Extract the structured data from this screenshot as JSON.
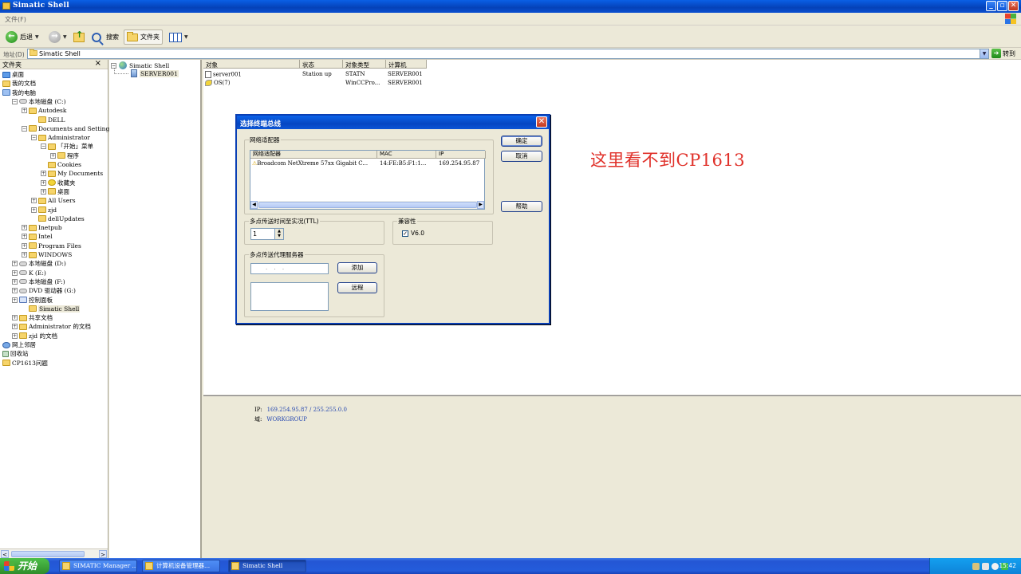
{
  "window": {
    "title": "Simatic Shell",
    "controls": [
      "_",
      "▫",
      "✕"
    ]
  },
  "menubar": {
    "file_label": "文件(F)"
  },
  "toolbar": {
    "back_label": "后退",
    "search_label": "搜索",
    "folders_label": "文件夹"
  },
  "address": {
    "label": "地址(D)",
    "value": "Simatic Shell",
    "go_label": "转到"
  },
  "folder_pane": {
    "header": "文件夹",
    "close": "×",
    "items": [
      {
        "label": "桌面",
        "expander": "",
        "icon": "desktop-icon"
      },
      {
        "label": "我的文档",
        "expander": "",
        "icon": "folder-icon"
      },
      {
        "label": "我的电脑",
        "expander": "",
        "icon": "computer-icon"
      },
      {
        "label": "本地磁盘 (C:)",
        "expander": "−",
        "icon": "drive-icon"
      },
      {
        "label": "Autodesk",
        "expander": "+",
        "icon": "folder-icon"
      },
      {
        "label": "DELL",
        "expander": "",
        "icon": "folder-icon"
      },
      {
        "label": "Documents and Settings",
        "expander": "−",
        "icon": "folder-icon"
      },
      {
        "label": "Administrator",
        "expander": "−",
        "icon": "folder-icon"
      },
      {
        "label": "「开始」菜单",
        "expander": "−",
        "icon": "folder-icon"
      },
      {
        "label": "程序",
        "expander": "+",
        "icon": "folder-icon"
      },
      {
        "label": "Cookies",
        "expander": "",
        "icon": "folder-icon"
      },
      {
        "label": "My Documents",
        "expander": "+",
        "icon": "folder-icon"
      },
      {
        "label": "收藏夹",
        "expander": "+",
        "icon": "star-icon"
      },
      {
        "label": "桌面",
        "expander": "+",
        "icon": "folder-icon"
      },
      {
        "label": "All Users",
        "expander": "+",
        "icon": "folder-icon"
      },
      {
        "label": "zjd",
        "expander": "+",
        "icon": "folder-icon"
      },
      {
        "label": "dellUpdates",
        "expander": "",
        "icon": "folder-icon"
      },
      {
        "label": "Inetpub",
        "expander": "+",
        "icon": "folder-icon"
      },
      {
        "label": "Intel",
        "expander": "+",
        "icon": "folder-icon"
      },
      {
        "label": "Program Files",
        "expander": "+",
        "icon": "folder-icon"
      },
      {
        "label": "WINDOWS",
        "expander": "+",
        "icon": "folder-icon"
      },
      {
        "label": "本地磁盘 (D:)",
        "expander": "+",
        "icon": "drive-icon"
      },
      {
        "label": "K (E:)",
        "expander": "+",
        "icon": "drive-icon"
      },
      {
        "label": "本地磁盘 (F:)",
        "expander": "+",
        "icon": "drive-icon"
      },
      {
        "label": "DVD 驱动器 (G:)",
        "expander": "+",
        "icon": "dvd-icon"
      },
      {
        "label": "控制面板",
        "expander": "+",
        "icon": "control-panel-icon"
      },
      {
        "label": "Simatic Shell",
        "expander": "",
        "icon": "folder-icon"
      },
      {
        "label": "共享文档",
        "expander": "+",
        "icon": "folder-icon"
      },
      {
        "label": "Administrator 的文档",
        "expander": "+",
        "icon": "folder-icon"
      },
      {
        "label": "zjd 的文档",
        "expander": "+",
        "icon": "folder-icon"
      },
      {
        "label": "网上邻居",
        "expander": "",
        "icon": "network-icon"
      },
      {
        "label": "回收站",
        "expander": "",
        "icon": "recycle-bin-icon"
      },
      {
        "label": "CP1613问题",
        "expander": "",
        "icon": "folder-icon"
      }
    ]
  },
  "project_tree": {
    "root": "Simatic Shell",
    "child": "SERVER001"
  },
  "object_list": {
    "columns": [
      "对象",
      "状态",
      "对象类型",
      "计算机"
    ],
    "rows": [
      {
        "object": "server001",
        "status": "Station up",
        "type": "STATN",
        "computer": "SERVER001"
      },
      {
        "object": "OS(7)",
        "status": "",
        "type": "WinCCPro...",
        "computer": "SERVER001"
      }
    ]
  },
  "annotation": "这里看不到CP1613",
  "details": {
    "ip_label": "IP:",
    "ip_value": "169.254.95.87 / 255.255.0.0",
    "domain_label": "域:",
    "domain_value": "WORKGROUP"
  },
  "dialog": {
    "title": "选择终端总线",
    "close": "✕",
    "adapter_group": "网络适配器",
    "adapter_columns": [
      "网络适配器",
      "MAC",
      "IP"
    ],
    "adapter_row": {
      "name": "Broadcom NetXtreme 57xx Gigabit C...",
      "mac": "14:FE:B5:F1:1...",
      "ip": "169.254.95.87"
    },
    "ok": "确定",
    "cancel": "取消",
    "help": "帮助",
    "ttl_group": "多点传送时间至实况(TTL)",
    "ttl_value": "1",
    "compat_group": "兼容性",
    "compat_option": "V6.0",
    "compat_checked": true,
    "proxy_group": "多点传送代理服务器",
    "ip_placeholder": ". . .",
    "add": "添加",
    "remote": "远程"
  },
  "taskbar": {
    "start": "开始",
    "tasks": [
      "SIMATIC Manager ...",
      "计算机设备管理器...",
      "Simatic Shell"
    ],
    "clock": "15:42"
  }
}
